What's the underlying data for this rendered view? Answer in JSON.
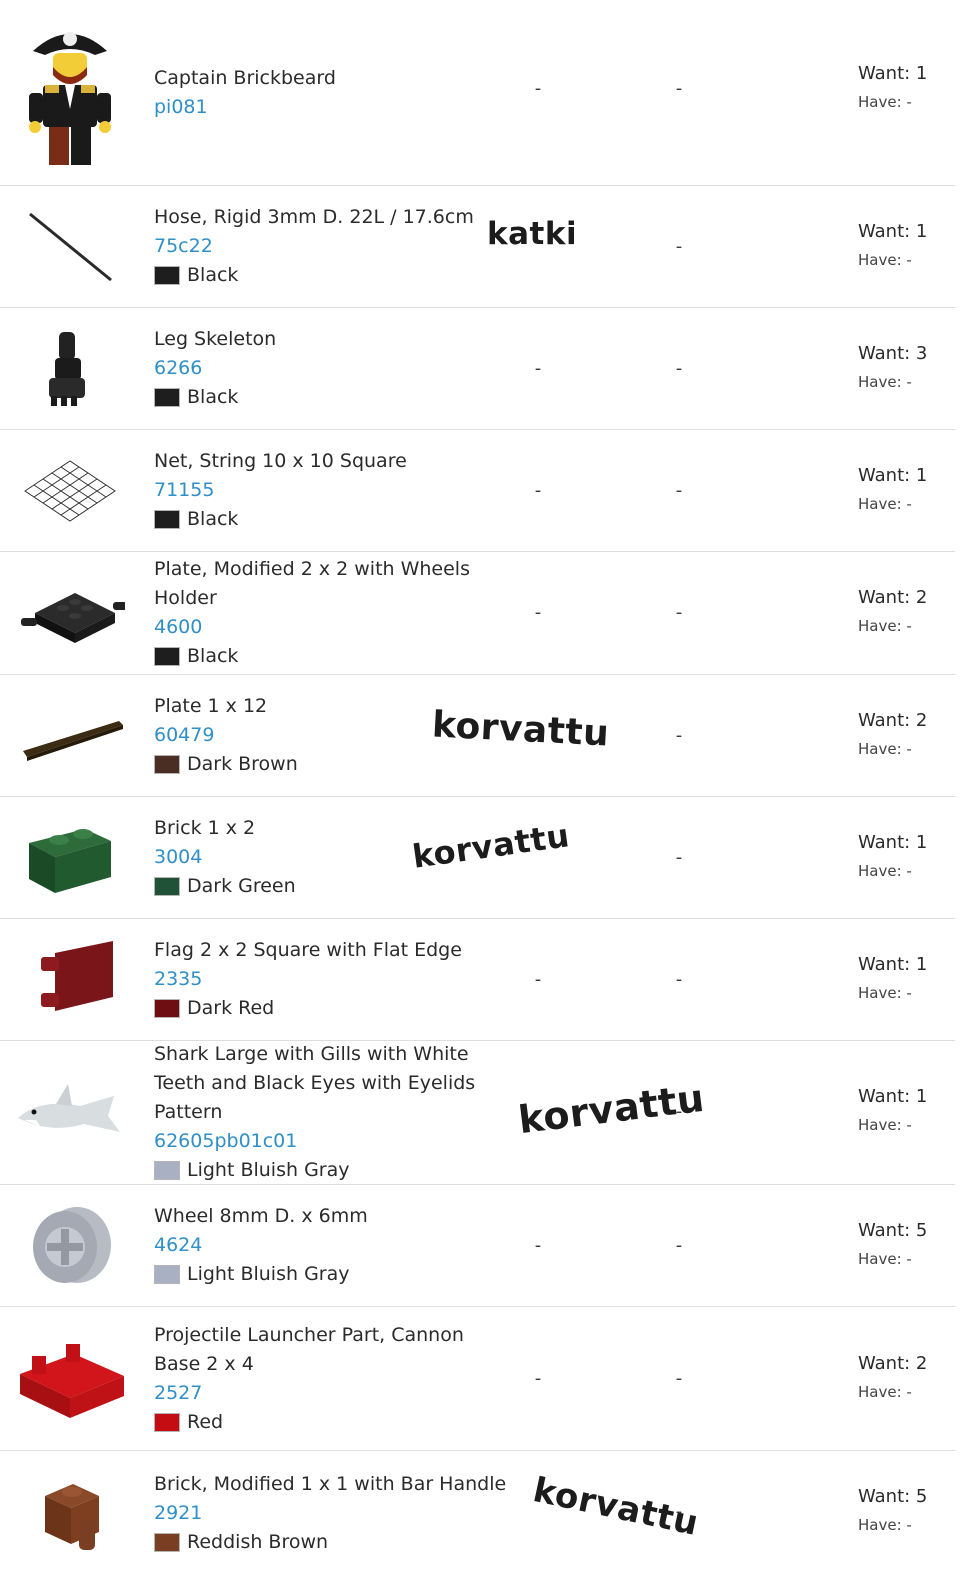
{
  "items": [
    {
      "name": "Captain Brickbeard",
      "part_no": "pi081",
      "color": "",
      "swatch": "",
      "col1": "-",
      "col2": "-",
      "want": "Want: 1",
      "have": "Have: -",
      "icon": "minifig-pirate-icon"
    },
    {
      "name": "Hose, Rigid 3mm D. 22L / 17.6cm",
      "part_no": "75c22",
      "color": "Black",
      "swatch": "#1e1e1e",
      "col1": "",
      "col2": "-",
      "want": "Want: 1",
      "have": "Have: -",
      "icon": "hose-icon",
      "note": "katki"
    },
    {
      "name": "Leg Skeleton",
      "part_no": "6266",
      "color": "Black",
      "swatch": "#1e1e1e",
      "col1": "-",
      "col2": "-",
      "want": "Want: 3",
      "have": "Have: -",
      "icon": "leg-skeleton-icon"
    },
    {
      "name": "Net, String 10 x 10 Square",
      "part_no": "71155",
      "color": "Black",
      "swatch": "#1e1e1e",
      "col1": "-",
      "col2": "-",
      "want": "Want: 1",
      "have": "Have: -",
      "icon": "net-icon"
    },
    {
      "name": "Plate, Modified 2 x 2 with Wheels Holder",
      "part_no": "4600",
      "color": "Black",
      "swatch": "#1e1e1e",
      "col1": "-",
      "col2": "-",
      "want": "Want: 2",
      "have": "Have: -",
      "icon": "wheel-holder-plate-icon"
    },
    {
      "name": "Plate 1 x 12",
      "part_no": "60479",
      "color": "Dark Brown",
      "swatch": "#4a2e24",
      "col1": "",
      "col2": "-",
      "want": "Want: 2",
      "have": "Have: -",
      "icon": "plate-1x12-icon",
      "note": "korvattu"
    },
    {
      "name": "Brick 1 x 2",
      "part_no": "3004",
      "color": "Dark Green",
      "swatch": "#1f5236",
      "col1": "",
      "col2": "-",
      "want": "Want: 1",
      "have": "Have: -",
      "icon": "brick-1x2-icon",
      "note": "korvattu"
    },
    {
      "name": "Flag 2 x 2 Square with Flat Edge",
      "part_no": "2335",
      "color": "Dark Red",
      "swatch": "#6e0e12",
      "col1": "-",
      "col2": "-",
      "want": "Want: 1",
      "have": "Have: -",
      "icon": "flag-icon"
    },
    {
      "name": "Shark Large with Gills with White Teeth and Black Eyes with Eyelids Pattern",
      "part_no": "62605pb01c01",
      "color": "Light Bluish Gray",
      "swatch": "#a9b0c4",
      "col1": "",
      "col2": "-",
      "want": "Want: 1",
      "have": "Have: -",
      "icon": "shark-icon",
      "note": "korvattu"
    },
    {
      "name": "Wheel 8mm D. x 6mm",
      "part_no": "4624",
      "color": "Light Bluish Gray",
      "swatch": "#a9b0c4",
      "col1": "-",
      "col2": "-",
      "want": "Want: 5",
      "have": "Have: -",
      "icon": "wheel-icon"
    },
    {
      "name": "Projectile Launcher Part, Cannon Base 2 x 4",
      "part_no": "2527",
      "color": "Red",
      "swatch": "#c40d12",
      "col1": "-",
      "col2": "-",
      "want": "Want: 2",
      "have": "Have: -",
      "icon": "cannon-base-icon"
    },
    {
      "name": "Brick, Modified 1 x 1 with Bar Handle",
      "part_no": "2921",
      "color": "Reddish Brown",
      "swatch": "#7a3e22",
      "col1": "",
      "col2": "-",
      "want": "Want: 5",
      "have": "Have: -",
      "icon": "brick-bar-handle-icon",
      "note": "korvattu"
    }
  ]
}
